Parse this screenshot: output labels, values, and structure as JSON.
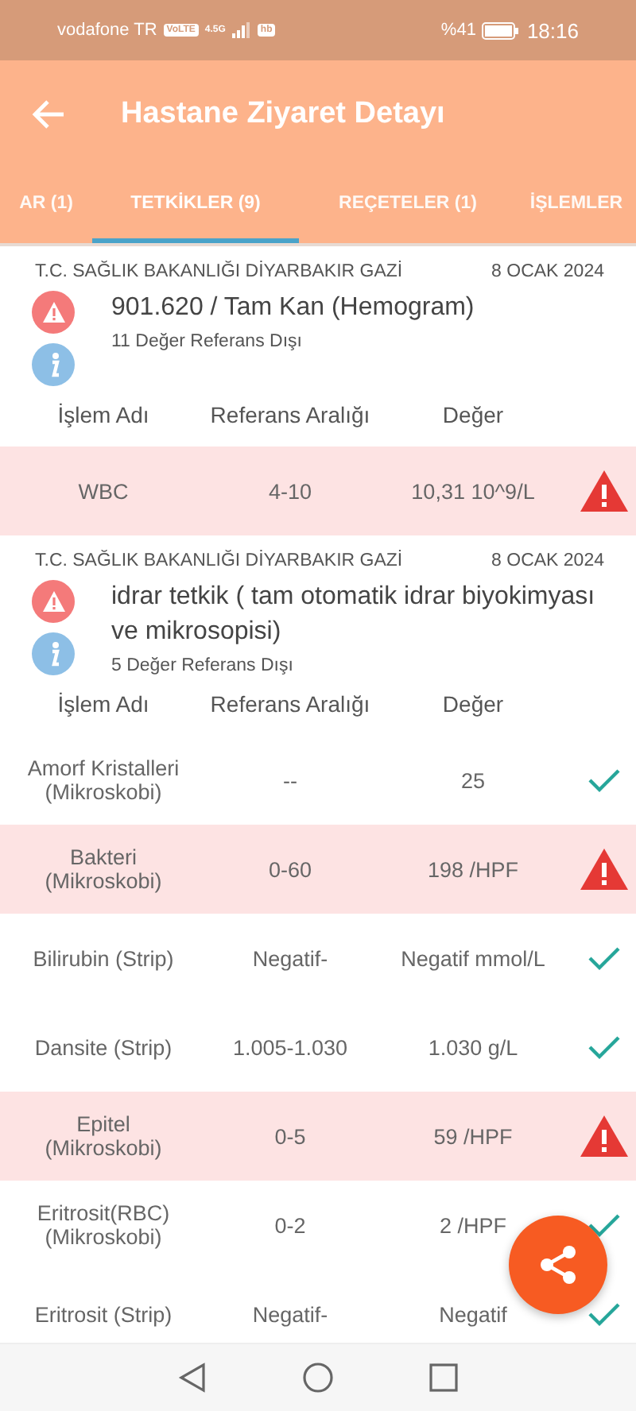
{
  "status_bar": {
    "carrier": "vodafone TR",
    "volte": "VoLTE",
    "network": "4.5G",
    "app_badge": "hb",
    "battery": "%41",
    "time": "18:16"
  },
  "app_bar": {
    "title": "Hastane Ziyaret Detayı"
  },
  "tabs": [
    {
      "label": "AR (1)",
      "selected": false
    },
    {
      "label": "TETKİKLER (9)",
      "selected": true
    },
    {
      "label": "REÇETELER (1)",
      "selected": false
    },
    {
      "label": "İŞLEMLER",
      "selected": false
    }
  ],
  "tests": [
    {
      "hospital": "T.C. SAĞLIK BAKANLIĞI DİYARBAKIR GAZİ",
      "date": "8 OCAK 2024",
      "title": "901.620 / Tam Kan (Hemogram)",
      "summary": "11 Değer Referans Dışı",
      "columns": [
        "İşlem Adı",
        "Referans Aralığı",
        "Değer"
      ],
      "rows": [
        {
          "name": "WBC",
          "range": "4-10",
          "value": "10,31 10^9/L",
          "flagged": true
        }
      ]
    },
    {
      "hospital": "T.C. SAĞLIK BAKANLIĞI DİYARBAKIR GAZİ",
      "date": "8 OCAK 2024",
      "title": "idrar tetkik ( tam otomatik idrar biyokimyası ve mikrosopisi)",
      "summary": "5 Değer Referans Dışı",
      "columns": [
        "İşlem Adı",
        "Referans Aralığı",
        "Değer"
      ],
      "rows": [
        {
          "name": "Amorf Kristalleri (Mikroskobi)",
          "range": "--",
          "value": "25",
          "flagged": false
        },
        {
          "name": "Bakteri (Mikroskobi)",
          "range": "0-60",
          "value": "198 /HPF",
          "flagged": true
        },
        {
          "name": "Bilirubin (Strip)",
          "range": "Negatif-",
          "value": "Negatif mmol/L",
          "flagged": false
        },
        {
          "name": "Dansite (Strip)",
          "range": "1.005-1.030",
          "value": "1.030 g/L",
          "flagged": false
        },
        {
          "name": "Epitel (Mikroskobi)",
          "range": "0-5",
          "value": "59 /HPF",
          "flagged": true
        },
        {
          "name": "Eritrosit(RBC) (Mikroskobi)",
          "range": "0-2",
          "value": "2 /HPF",
          "flagged": false
        },
        {
          "name": "Eritrosit (Strip)",
          "range": "Negatif-",
          "value": "Negatif",
          "flagged": false
        }
      ]
    }
  ]
}
